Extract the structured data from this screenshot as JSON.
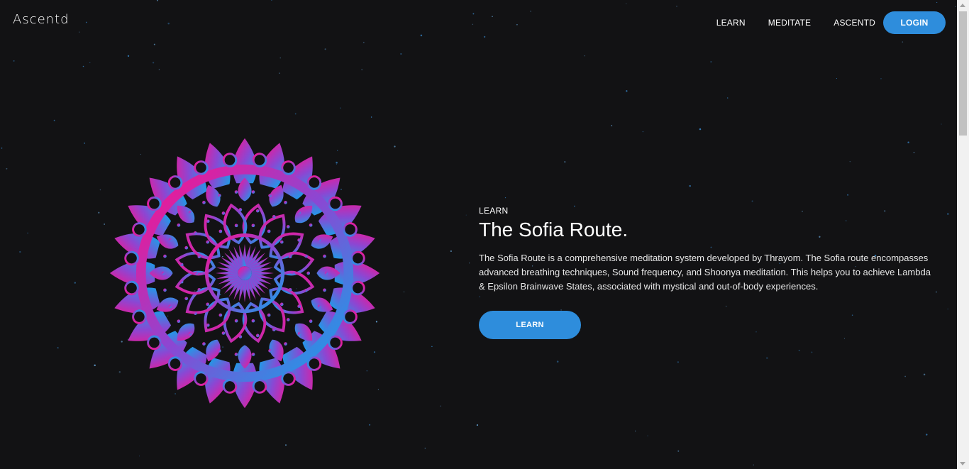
{
  "brand": {
    "logo_text": "Ascentd"
  },
  "nav": {
    "items": [
      {
        "label": "LEARN"
      },
      {
        "label": "MEDITATE"
      },
      {
        "label": "ASCENTD"
      }
    ],
    "login_label": "LOGIN"
  },
  "hero": {
    "eyebrow": "LEARN",
    "title": "The Sofia Route.",
    "description": "The Sofia Route is a comprehensive meditation system developed by Thrayom. The Sofia route encompasses advanced breathing techniques, Sound frequency, and Shoonya meditation. This helps you to achieve Lambda & Epsilon Brainwave States, associated with mystical and out-of-body experiences.",
    "button_label": "LEARN",
    "image_icon": "mandala-icon"
  },
  "colors": {
    "background": "#121214",
    "accent": "#2e8ddc",
    "mandala_gradient_start": "#e8168c",
    "mandala_gradient_mid": "#8a45d0",
    "mandala_gradient_end": "#1e9be6"
  }
}
